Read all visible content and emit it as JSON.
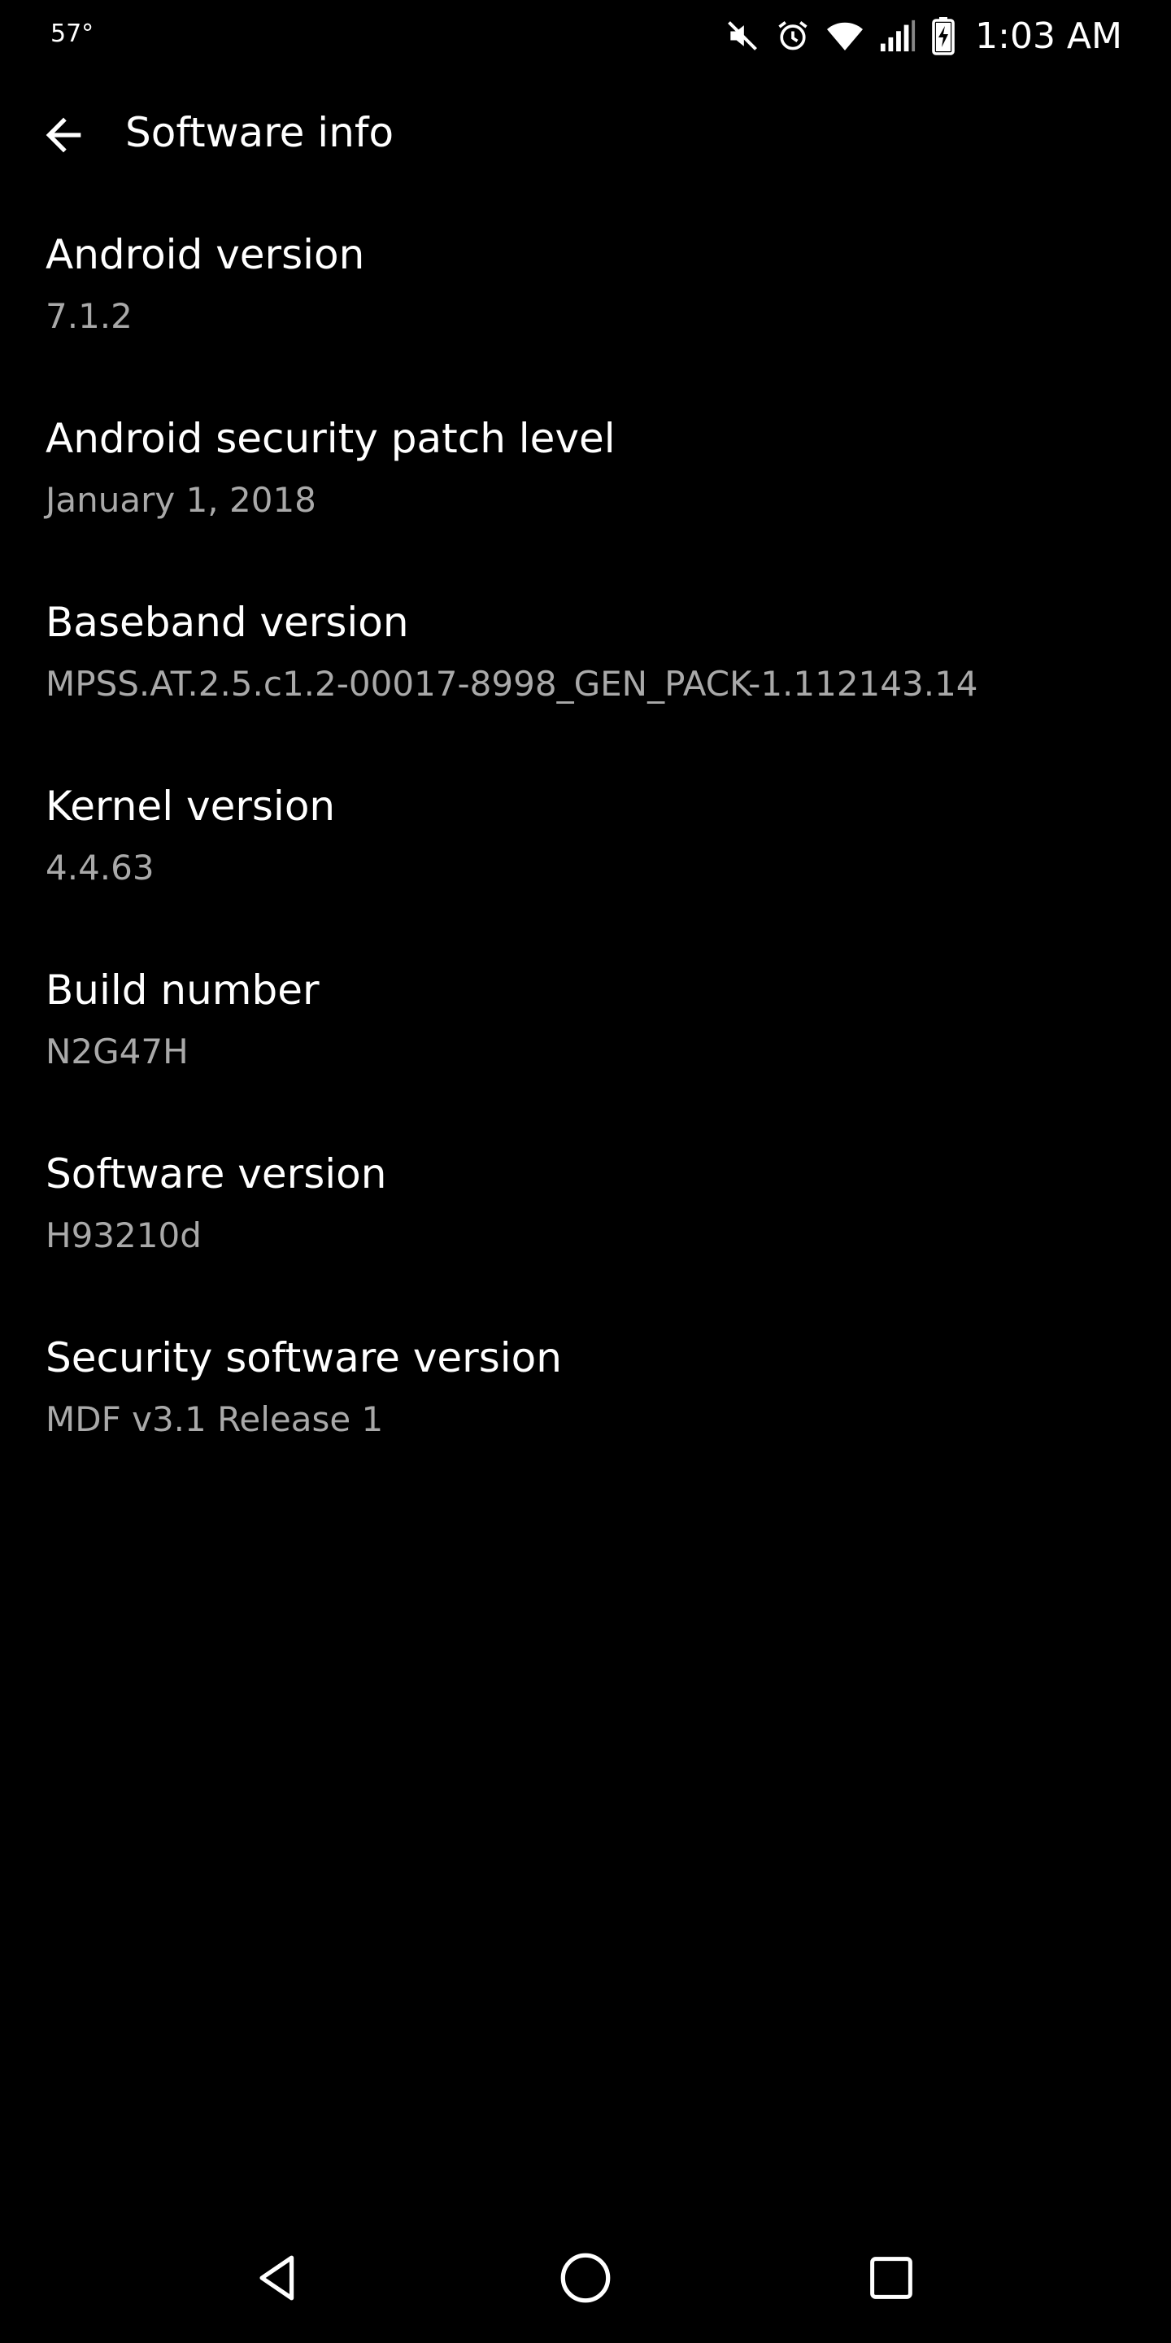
{
  "status_bar": {
    "temperature": "57°",
    "time": "1:03 AM",
    "icons": [
      "mute-icon",
      "alarm-icon",
      "wifi-icon",
      "signal-icon",
      "battery-charging-icon"
    ]
  },
  "app_bar": {
    "title": "Software info",
    "back_icon": "arrow-back-icon"
  },
  "items": [
    {
      "title": "Android version",
      "value": "7.1.2"
    },
    {
      "title": "Android security patch level",
      "value": "January 1, 2018"
    },
    {
      "title": "Baseband version",
      "value": "MPSS.AT.2.5.c1.2-00017-8998_GEN_PACK-1.112143.14"
    },
    {
      "title": "Kernel version",
      "value": "4.4.63"
    },
    {
      "title": "Build number",
      "value": "N2G47H"
    },
    {
      "title": "Software version",
      "value": "H93210d"
    },
    {
      "title": "Security software version",
      "value": "MDF v3.1 Release 1"
    }
  ],
  "nav_bar": {
    "icons": [
      "nav-back-icon",
      "nav-home-icon",
      "nav-recents-icon"
    ]
  },
  "colors": {
    "background": "#000000",
    "primary_text": "#ffffff",
    "secondary_text": "#a9a9a9"
  }
}
